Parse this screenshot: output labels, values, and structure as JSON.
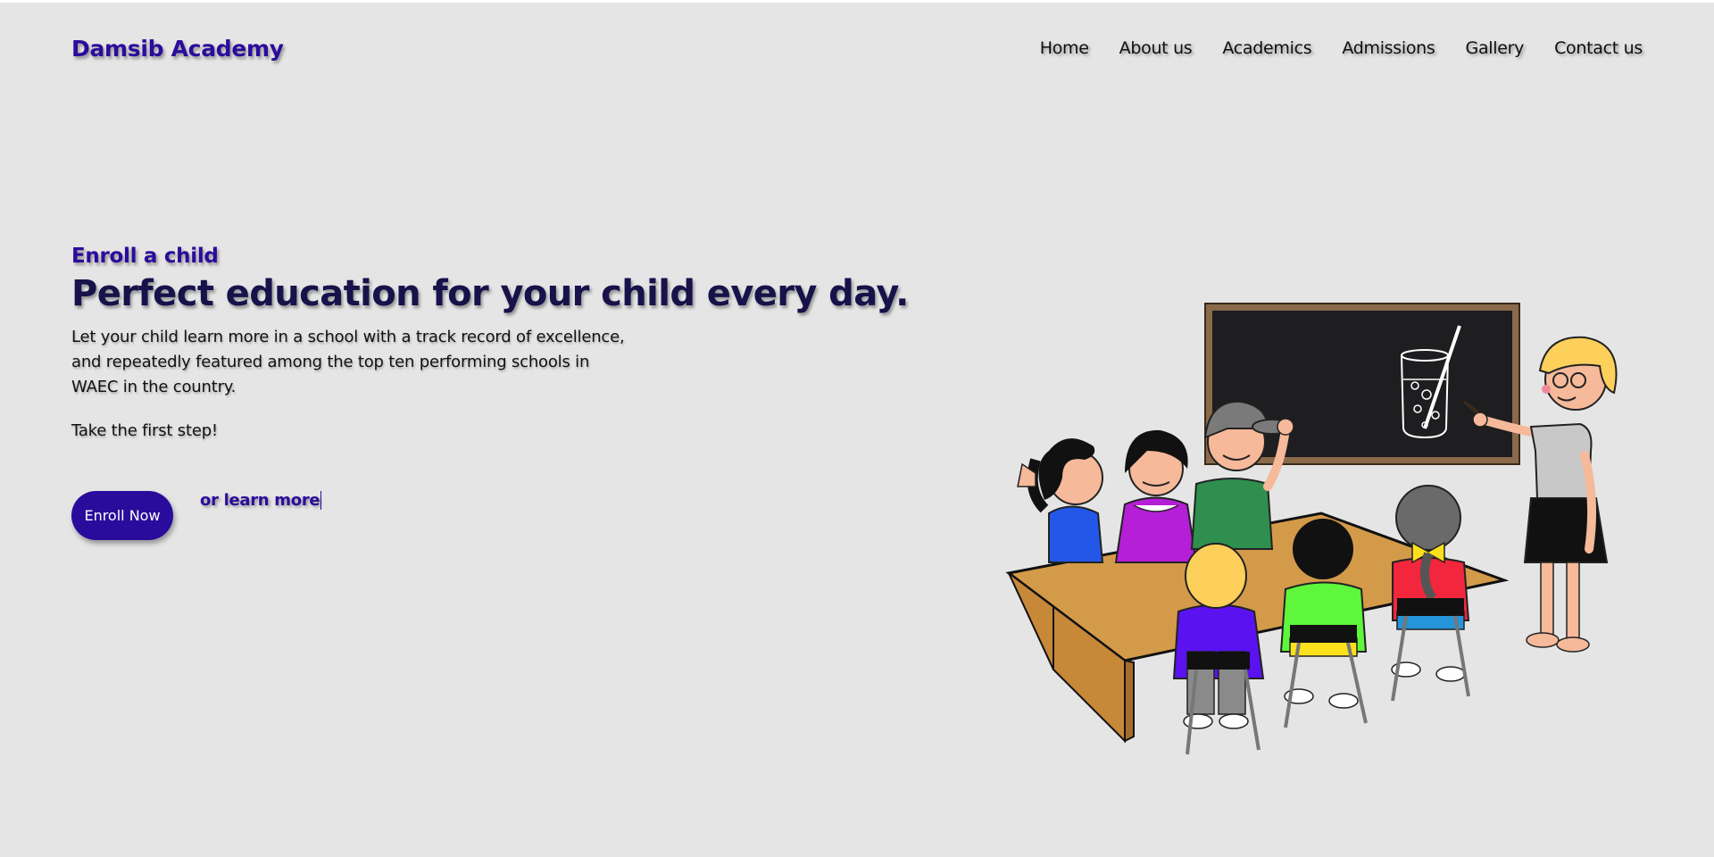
{
  "header": {
    "logo": "Damsib Academy",
    "nav": [
      "Home",
      "About us",
      "Academics",
      "Admissions",
      "Gallery",
      "Contact us"
    ]
  },
  "hero": {
    "eyebrow": "Enroll a child",
    "headline": "Perfect education for your child every day.",
    "description": "Let your child learn more in a school with a track record of excellence, and repeatedly featured among the top ten performing schools in WAEC in the country.",
    "cta_text": "Take the first step!",
    "enroll_button": "Enroll Now",
    "learn_more_link": "or learn more"
  },
  "illustration": {
    "icon": "classroom-illustration"
  },
  "colors": {
    "background": "#e5e5e5",
    "brand": "#2a0c9c",
    "headline": "#17124a"
  }
}
